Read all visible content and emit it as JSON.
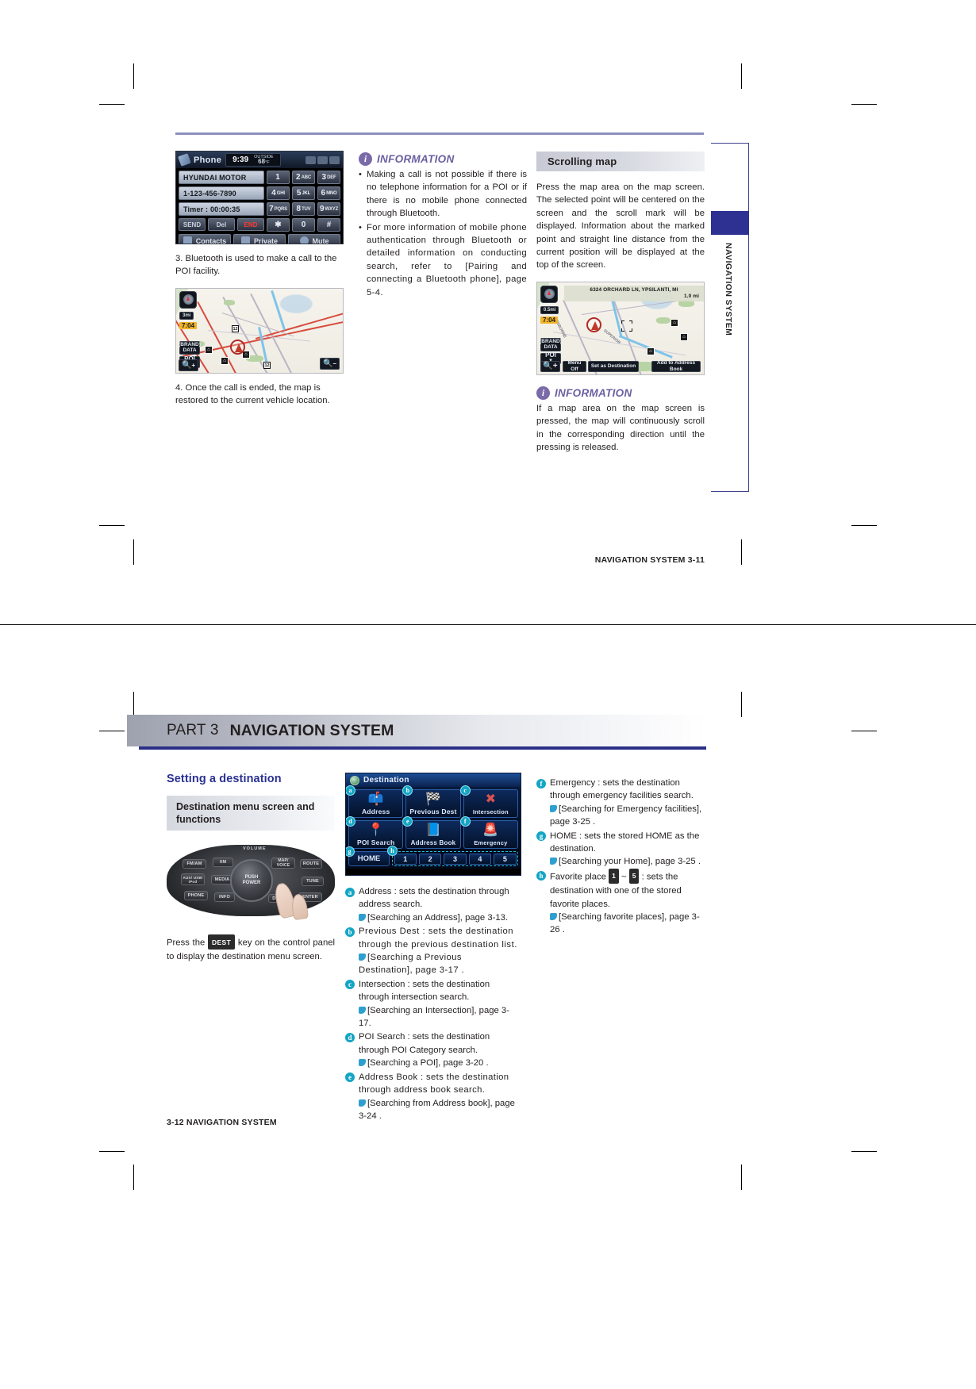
{
  "document": {
    "part_label": "PART 3",
    "part_title": "NAVIGATION SYSTEM"
  },
  "page1": {
    "phone_screen": {
      "title": "Phone",
      "time": "9:39",
      "temp_label_line1": "OUTSIDE",
      "temp_value": "68",
      "temp_unit": "°F",
      "fields": [
        "HYUNDAI MOTOR",
        "1-123-456-7890",
        "Timer : 00:00:35"
      ],
      "action_buttons": [
        "SEND",
        "Del",
        "END"
      ],
      "keypad": [
        {
          "digit": "1",
          "letters": ""
        },
        {
          "digit": "2",
          "letters": "ABC"
        },
        {
          "digit": "3",
          "letters": "DEF"
        },
        {
          "digit": "4",
          "letters": "GHI"
        },
        {
          "digit": "5",
          "letters": "JKL"
        },
        {
          "digit": "6",
          "letters": "MNO"
        },
        {
          "digit": "7",
          "letters": "PQRS"
        },
        {
          "digit": "8",
          "letters": "TUV"
        },
        {
          "digit": "9",
          "letters": "WXYZ"
        },
        {
          "digit": "✱",
          "letters": ""
        },
        {
          "digit": "0",
          "letters": ""
        },
        {
          "digit": "#",
          "letters": ""
        }
      ],
      "bottom_buttons": [
        "Contacts",
        "Private",
        "Mute"
      ]
    },
    "step3": "3. Bluetooth is used to make a call to the POI facility.",
    "step4": "4. Once the call is ended, the map is restored to the current vehicle location.",
    "map1": {
      "scale": "3mi",
      "clock": "7:04",
      "data_label_1": "(BRAND)",
      "data_label_2": "DATA",
      "poi_button": "POI",
      "zoom_in": "+",
      "zoom_out": "−",
      "shield_labels": [
        "12",
        "12"
      ]
    },
    "information_1": {
      "heading": "INFORMATION",
      "bullets": [
        "Making a call is not possible if there is no telephone information for a POI or if there is no mobile phone connected through Bluetooth.",
        "For more information of mobile phone authentication through Bluetooth or detailed information on conducting search, refer to  [Pairing and connecting a  Bluetooth phone], page 5-4."
      ]
    },
    "scrolling_map": {
      "heading": "Scrolling map",
      "body": "Press the map area on the map screen. The selected point will be centered on the screen and the scroll mark will be displayed. Information about the marked point and straight line distance from the current position will be displayed at the top of the screen."
    },
    "map2": {
      "address": "6324 ORCHARD LN, YPSILANTI, MI",
      "distance": "1.0 mi",
      "scale": "0.5mi",
      "clock": "7:04",
      "data_label_1": "(BRAND)",
      "data_label_2": "DATA",
      "poi_button": "POI",
      "menu_off": "Menu Off",
      "set_as_destination": "Set as Destination",
      "add_to_address_book": "Add to Address Book",
      "street_label_1": "OSBORNE",
      "street_label_2": "SUPERIOR"
    },
    "information_2": {
      "heading": "INFORMATION",
      "body": "If a map area on the map screen is pressed, the map will continuously scroll in the corresponding direction until the pressing is released."
    },
    "side_tab_label": "NAVIGATION SYSTEM",
    "footer": "NAVIGATION SYSTEM    3-11"
  },
  "page2": {
    "section_title": "Setting a destination",
    "subsection_title": "Destination menu screen and functions",
    "panel": {
      "volume_label": "VOLUME",
      "keys": [
        "FM/AM",
        "XM",
        "MAP/ VOICE",
        "ROUTE",
        "AUX/ USB/ iPod",
        "MEDIA",
        "TUNE",
        "PHONE",
        "INFO",
        "ENTER",
        "DEST"
      ],
      "knob_line1": "PUSH",
      "knob_line2": "POWER"
    },
    "press_note_pre": "Press the",
    "press_note_key": "DEST",
    "press_note_post": "key on the control panel to display the destination menu screen.",
    "dest_screen": {
      "title": "Destination",
      "cells": [
        {
          "badge": "a",
          "label": "Address",
          "icon": "mailbox-icon",
          "glyph": "📫"
        },
        {
          "badge": "b",
          "label": "Previous Dest",
          "icon": "checkered-flag-icon",
          "glyph": "🏁"
        },
        {
          "badge": "c",
          "label": "Intersection",
          "icon": "crossroads-icon",
          "glyph": "✖"
        },
        {
          "badge": "d",
          "label": "POI Search",
          "icon": "pushpin-map-icon",
          "glyph": "📍"
        },
        {
          "badge": "e",
          "label": "Address Book",
          "icon": "address-book-icon",
          "glyph": "📘"
        },
        {
          "badge": "f",
          "label": "Emergency",
          "icon": "siren-icon",
          "glyph": "🚨"
        }
      ],
      "home_badge": "g",
      "home_label": "HOME",
      "favorites_badge": "h",
      "favorites": [
        "1",
        "2",
        "3",
        "4",
        "5"
      ]
    },
    "items": [
      {
        "badge": "a",
        "text": "Address : sets the destination through address search.",
        "ref": "[Searching an Address], page 3-13."
      },
      {
        "badge": "b",
        "text": "Previous Dest : sets the destination through the previous destination list.",
        "ref": "[Searching a Previous Destination], page 3-17 ."
      },
      {
        "badge": "c",
        "text": "Intersection : sets the destination through intersection search.",
        "ref": "[Searching an Intersection], page 3-17."
      },
      {
        "badge": "d",
        "text": "POI Search : sets the destination through POI Category search.",
        "ref": "[Searching a POI], page 3-20 ."
      },
      {
        "badge": "e",
        "text": "Address Book : sets the destination through address book search.",
        "ref": "[Searching from Address book], page 3-24 ."
      }
    ],
    "items_right": [
      {
        "badge": "f",
        "text": "Emergency : sets the destination through emergency facilities search.",
        "ref": "[Searching for Emergency facilities], page 3-25 ."
      },
      {
        "badge": "g",
        "text": "HOME : sets the stored HOME as the destination.",
        "ref": "[Searching your Home], page 3-25 ."
      }
    ],
    "favorite_item": {
      "badge": "h",
      "text_pre": "Favorite place",
      "key_1": "1",
      "tilde": "~",
      "key_2": "5",
      "text_post": ": sets the destination with one of the stored favorite places.",
      "ref": "[Searching favorite places], page 3-26 ."
    },
    "footer": "3-12    NAVIGATION SYSTEM"
  }
}
